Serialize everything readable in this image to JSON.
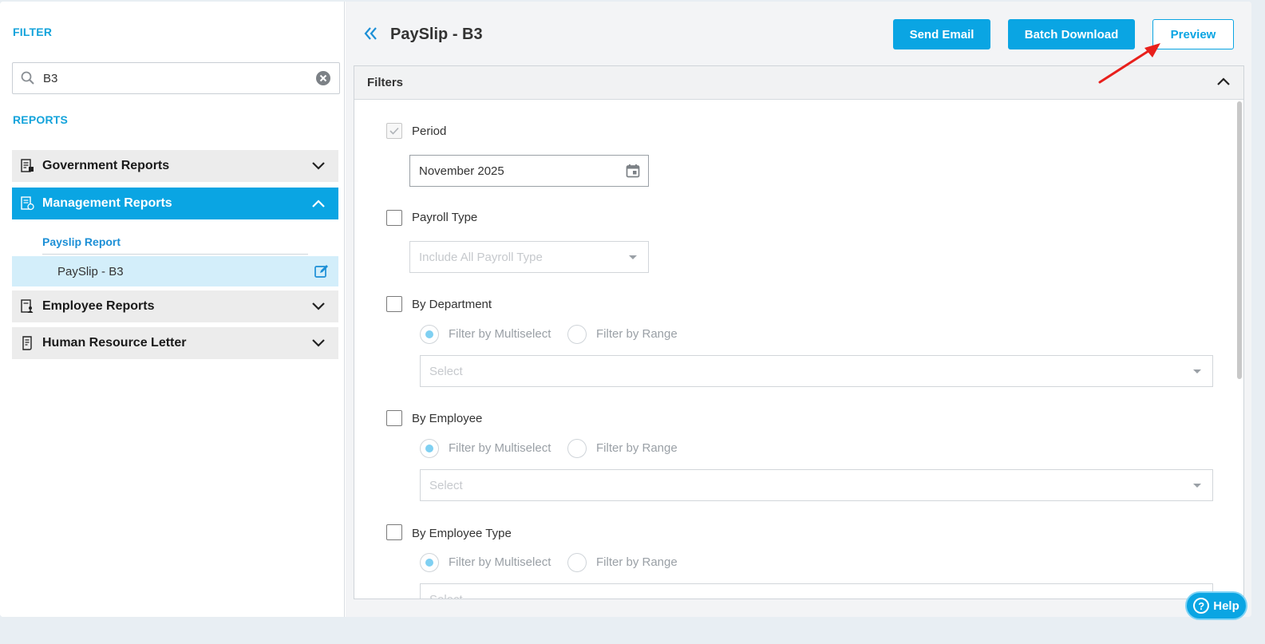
{
  "sidebar": {
    "filter_label": "FILTER",
    "search": {
      "value": "B3",
      "placeholder": ""
    },
    "reports_label": "REPORTS",
    "groups": [
      {
        "label": "Government Reports",
        "icon": "government-report-icon",
        "expanded": false
      },
      {
        "label": "Management Reports",
        "icon": "management-report-icon",
        "expanded": true
      },
      {
        "label": "Employee Reports",
        "icon": "employee-report-icon",
        "expanded": false
      },
      {
        "label": "Human Resource Letter",
        "icon": "hr-letter-icon",
        "expanded": false
      }
    ],
    "subsection_title": "Payslip Report",
    "sub_item": "PaySlip - B3"
  },
  "header": {
    "title": "PaySlip - B3",
    "send_email": "Send Email",
    "batch_download": "Batch Download",
    "preview": "Preview"
  },
  "filters": {
    "title": "Filters",
    "period": {
      "label": "Period",
      "checked": true,
      "value": "November 2025"
    },
    "payroll_type": {
      "label": "Payroll Type",
      "checked": false,
      "placeholder": "Include All Payroll Type"
    },
    "by_department": {
      "label": "By Department",
      "checked": false,
      "radio1": "Filter by Multiselect",
      "radio2": "Filter by Range",
      "placeholder": "Select"
    },
    "by_employee": {
      "label": "By Employee",
      "checked": false,
      "radio1": "Filter by Multiselect",
      "radio2": "Filter by Range",
      "placeholder": "Select"
    },
    "by_employee_type": {
      "label": "By Employee Type",
      "checked": false,
      "radio1": "Filter by Multiselect",
      "radio2": "Filter by Range",
      "placeholder": "Select"
    }
  },
  "help_label": "Help",
  "colors": {
    "accent": "#0aa5e3",
    "accent_light": "#d3eefa",
    "arrow": "#e8201c"
  }
}
